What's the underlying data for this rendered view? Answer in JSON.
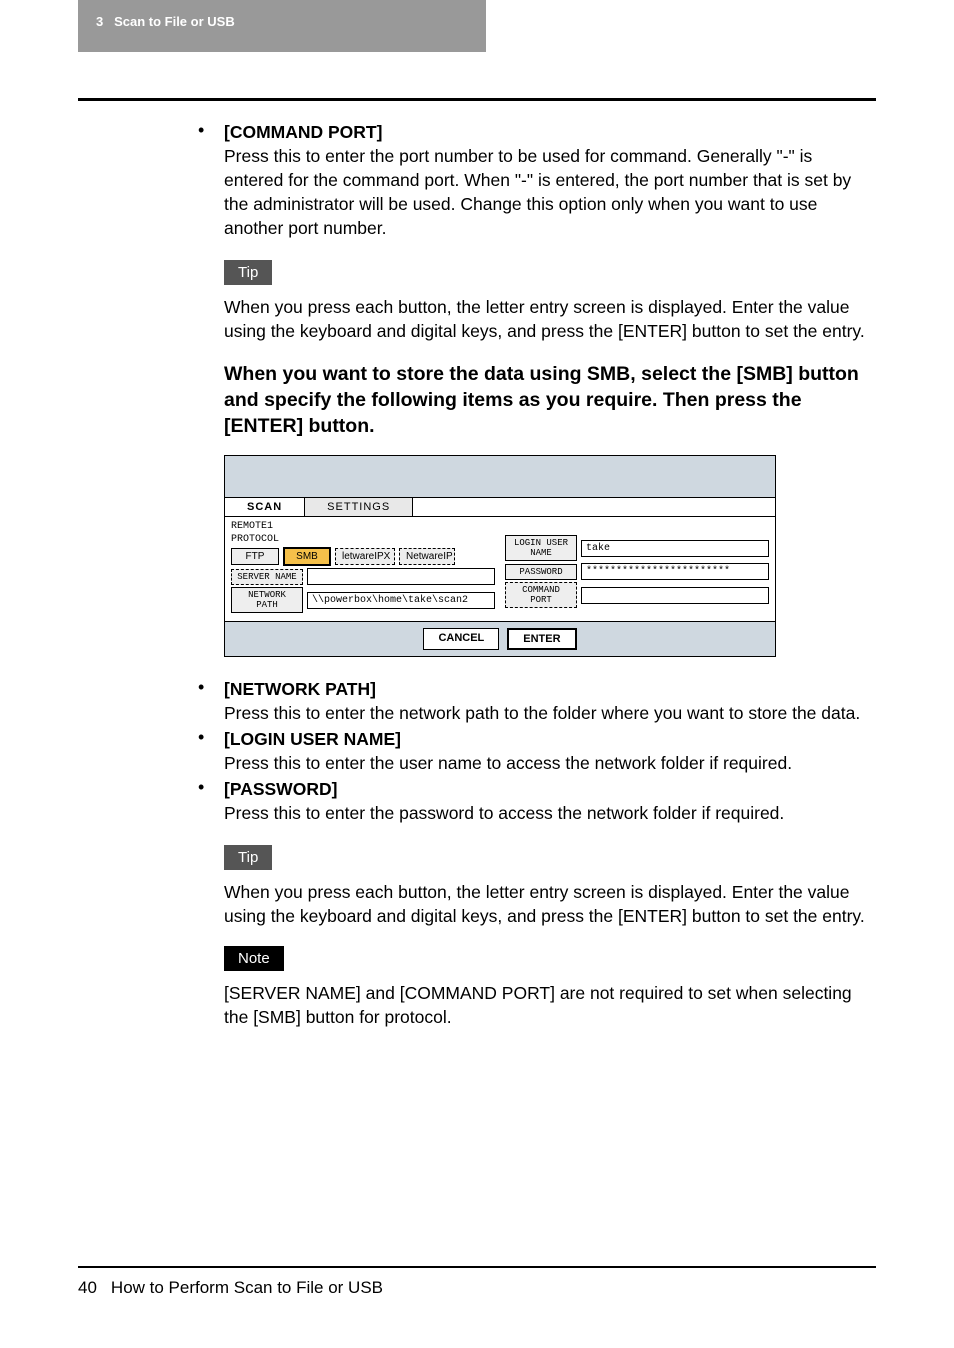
{
  "header": {
    "chapter_no": "3",
    "chapter_title": "Scan to File or USB"
  },
  "items1": {
    "command_port_title": "[COMMAND PORT]",
    "command_port_body": "Press this to enter the port number to be used for command. Generally \"-\" is entered for the command port. When \"-\" is entered, the port number that is set by the administrator will be used. Change this option only when you want to use another port number."
  },
  "tip1": {
    "label": "Tip",
    "body": "When you press each button, the letter entry screen is displayed. Enter the value using the keyboard and digital keys, and press the [ENTER] button to set the entry."
  },
  "subheading": "When you want to store the data using SMB, select the [SMB] button and specify the following items as you require. Then press the [ENTER] button.",
  "panel": {
    "tab_scan": "SCAN",
    "tab_settings": "SETTINGS",
    "remote": "REMOTE1",
    "protocol_label": "PROTOCOL",
    "ftp": "FTP",
    "smb": "SMB",
    "netware_ipx": "letwareIPX",
    "netware_ip": "NetwareIP",
    "server_name_btn": "SERVER NAME",
    "network_path_btn": "NETWORK PATH",
    "network_path_val": "\\\\powerbox\\home\\take\\scan2",
    "login_user_btn": "LOGIN USER NAME",
    "login_user_val": "take",
    "password_btn": "PASSWORD",
    "password_val": "************************",
    "command_port_btn": "COMMAND PORT",
    "cancel": "CANCEL",
    "enter": "ENTER"
  },
  "items2": {
    "network_path_title": "[NETWORK PATH]",
    "network_path_body": "Press this to enter the network path to the folder where you want to store the data.",
    "login_user_title": "[LOGIN USER NAME]",
    "login_user_body": "Press this to enter the user name to access the network folder if required.",
    "password_title": "[PASSWORD]",
    "password_body": "Press this to enter the password to access the network folder if required."
  },
  "tip2": {
    "label": "Tip",
    "body": "When you press each button, the letter entry screen is displayed. Enter the value using the keyboard and digital keys, and press the [ENTER] button to set the entry."
  },
  "note": {
    "label": "Note",
    "body": "[SERVER NAME] and [COMMAND PORT] are not required to set when selecting the [SMB] button for protocol."
  },
  "footer": {
    "page": "40",
    "title": "How to Perform Scan to File or USB"
  }
}
